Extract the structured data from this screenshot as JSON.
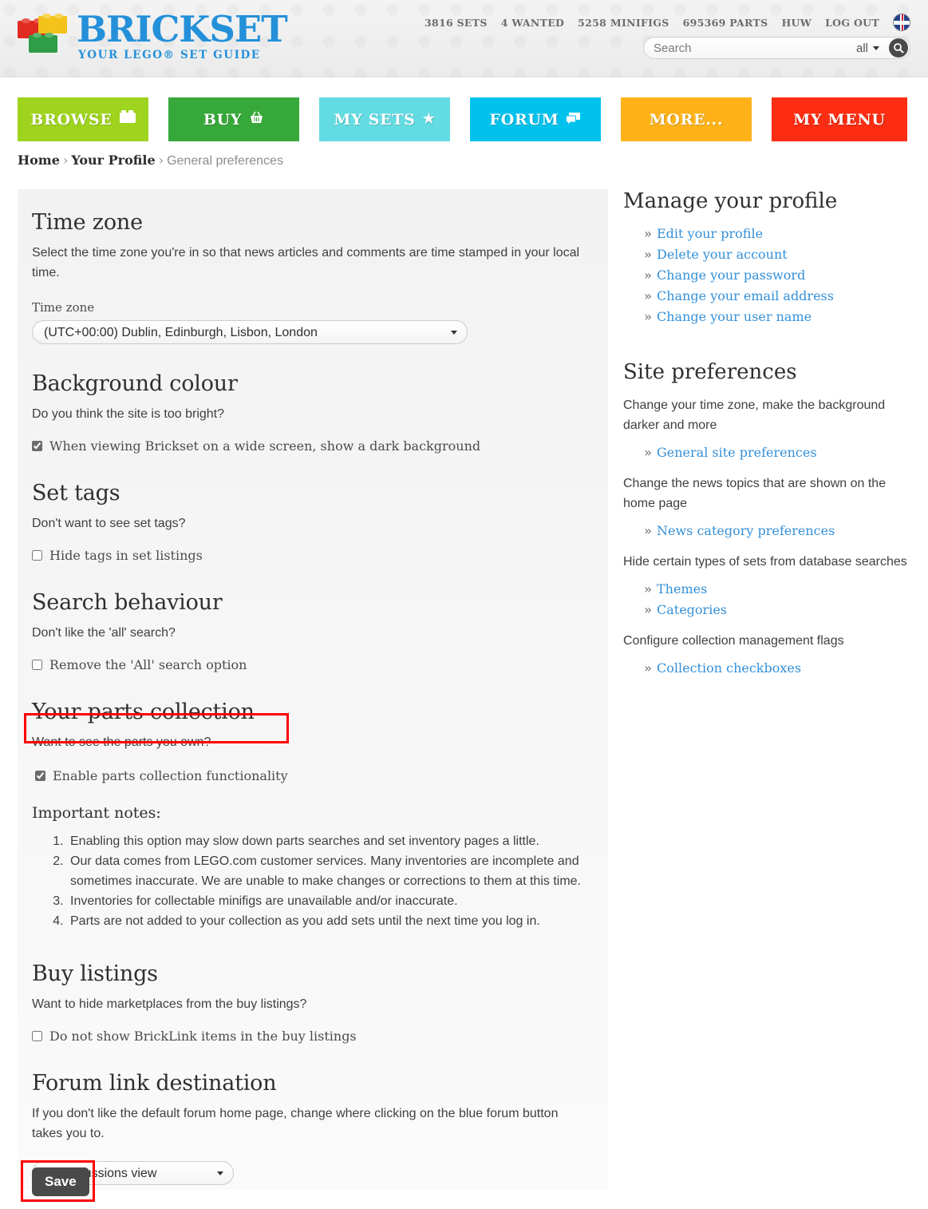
{
  "header": {
    "logo": {
      "title": "BRICKSET",
      "subtitle": "YOUR LEGO® SET GUIDE"
    },
    "stats": [
      {
        "label": "3816 SETS"
      },
      {
        "label": "4 WANTED"
      },
      {
        "label": "5258 MINIFIGS"
      },
      {
        "label": "695369 PARTS"
      },
      {
        "label": "HUW"
      },
      {
        "label": "LOG OUT"
      }
    ],
    "flag_icon": "uk-flag-icon",
    "search": {
      "placeholder": "Search",
      "value": "",
      "scope": "all",
      "search_icon": "search-icon"
    }
  },
  "nav": [
    {
      "label": "BROWSE",
      "icon": "brick-icon",
      "color": "#9ed41d"
    },
    {
      "label": "BUY",
      "icon": "basket-icon",
      "color": "#37a83a"
    },
    {
      "label": "MY SETS",
      "icon": "star-icon",
      "color": "#63dbe2"
    },
    {
      "label": "FORUM",
      "icon": "comment-icon",
      "color": "#00c2ed"
    },
    {
      "label": "MORE...",
      "icon": "",
      "color": "#ffb218"
    },
    {
      "label": "MY MENU",
      "icon": "",
      "color": "#fc2d12"
    }
  ],
  "breadcrumb": {
    "home": "Home",
    "profile": "Your Profile",
    "current": "General preferences",
    "separator": "›"
  },
  "main": {
    "timezone": {
      "heading": "Time zone",
      "lead": "Select the time zone you're in so that news articles and comments are time stamped in your local time.",
      "field_label": "Time zone",
      "value": "(UTC+00:00) Dublin, Edinburgh, Lisbon, London"
    },
    "background": {
      "heading": "Background colour",
      "lead": "Do you think the site is too bright?",
      "checkbox_label": "When viewing Brickset on a wide screen, show a dark background",
      "checked": true
    },
    "settags": {
      "heading": "Set tags",
      "lead": "Don't want to see set tags?",
      "checkbox_label": "Hide tags in set listings",
      "checked": false
    },
    "search_behaviour": {
      "heading": "Search behaviour",
      "lead": "Don't like the 'all' search?",
      "checkbox_label": "Remove the 'All' search option",
      "checked": false
    },
    "parts": {
      "heading": "Your parts collection",
      "lead": "Want to see the parts you own?",
      "checkbox_label": "Enable parts collection functionality",
      "checked": true,
      "highlighted": true,
      "notes_heading": "Important notes:",
      "notes": [
        "Enabling this option may slow down parts searches and set inventory pages a little.",
        "Our data comes from LEGO.com customer services. Many inventories are incomplete and sometimes inaccurate. We are unable to make changes or corrections to them at this time.",
        "Inventories for collectable minifigs are unavailable and/or inaccurate.",
        "Parts are not added to your collection as you add sets until the next time you log in."
      ]
    },
    "buy_listings": {
      "heading": "Buy listings",
      "lead": "Want to hide marketplaces from the buy listings?",
      "checkbox_label": "Do not show BrickLink items in the buy listings",
      "checked": false
    },
    "forum_link": {
      "heading": "Forum link destination",
      "lead": "If you don't like the default forum home page, change where clicking on the blue forum button takes you to.",
      "value": "All discussions view"
    },
    "save_label": "Save",
    "highlight_color": "#ff0000"
  },
  "sidebar": {
    "manage": {
      "heading": "Manage your profile",
      "links": [
        "Edit your profile",
        "Delete your account",
        "Change your password",
        "Change your email address",
        "Change your user name"
      ]
    },
    "site_prefs": {
      "heading": "Site preferences",
      "groups": [
        {
          "text": "Change your time zone, make the background darker and more",
          "links": [
            "General site preferences"
          ]
        },
        {
          "text": "Change the news topics that are shown on the home page",
          "links": [
            "News category preferences"
          ]
        },
        {
          "text": "Hide certain types of sets from database searches",
          "links": [
            "Themes",
            "Categories"
          ]
        },
        {
          "text": "Configure collection management flags",
          "links": [
            "Collection checkboxes"
          ]
        }
      ]
    },
    "bullet": "»"
  }
}
